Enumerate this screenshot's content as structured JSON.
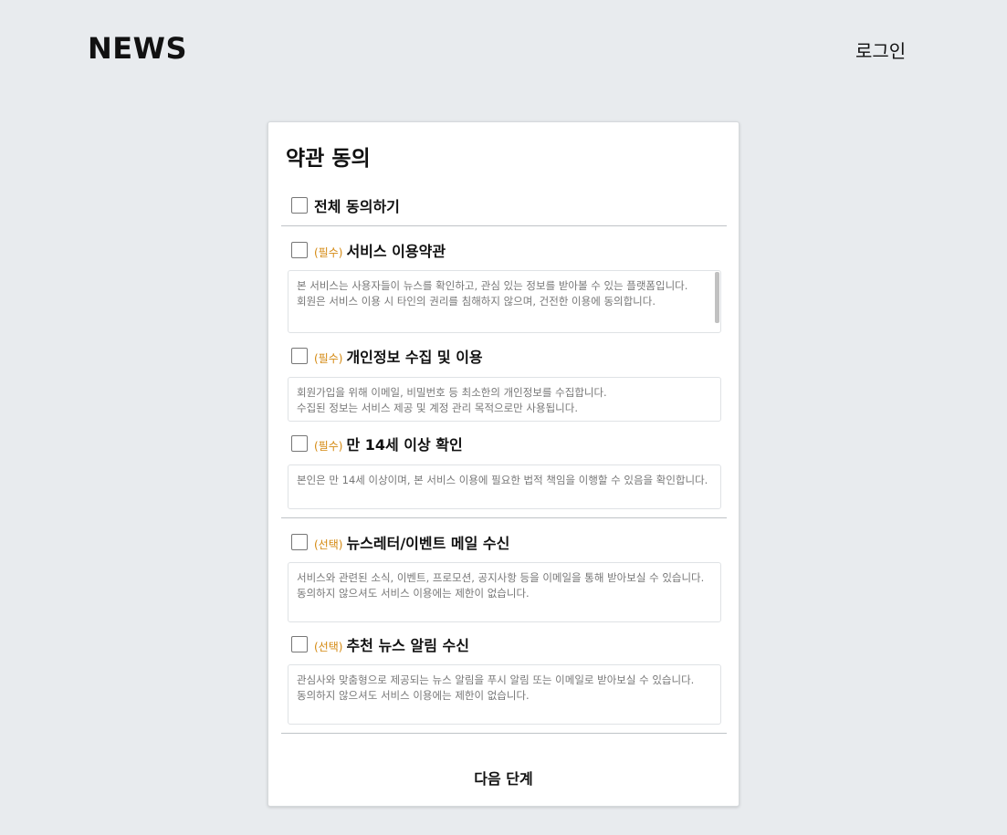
{
  "header": {
    "logo": "NEWS",
    "login": "로그인"
  },
  "card": {
    "title": "약관 동의",
    "agree_all": "전체 동의하기",
    "items": [
      {
        "tag": "(필수)",
        "label": "서비스 이용약관",
        "lines": [
          "본 서비스는 사용자들이 뉴스를 확인하고, 관심 있는 정보를 받아볼 수 있는 플랫폼입니다.",
          "회원은 서비스 이용 시 타인의 권리를 침해하지 않으며, 건전한 이용에 동의합니다."
        ]
      },
      {
        "tag": "(필수)",
        "label": "개인정보 수집 및 이용",
        "lines": [
          "회원가입을 위해 이메일, 비밀번호 등 최소한의 개인정보를 수집합니다.",
          "수집된 정보는 서비스 제공 및 계정 관리 목적으로만 사용됩니다."
        ]
      },
      {
        "tag": "(필수)",
        "label": "만 14세 이상 확인",
        "lines": [
          "본인은 만 14세 이상이며, 본 서비스 이용에 필요한 법적 책임을 이행할 수 있음을 확인합니다."
        ]
      },
      {
        "tag": "(선택)",
        "label": "뉴스레터/이벤트 메일 수신",
        "lines": [
          "서비스와 관련된 소식, 이벤트, 프로모션, 공지사항 등을 이메일을 통해 받아보실 수 있습니다.",
          "동의하지 않으셔도 서비스 이용에는 제한이 없습니다."
        ]
      },
      {
        "tag": "(선택)",
        "label": "추천 뉴스 알림 수신",
        "lines": [
          "관심사와 맞춤형으로 제공되는 뉴스 알림을 푸시 알림 또는 이메일로 받아보실 수 있습니다.",
          "동의하지 않으셔도 서비스 이용에는 제한이 없습니다."
        ]
      }
    ],
    "next": "다음 단계"
  },
  "colors": {
    "background": "#e8ebee",
    "tag": "#d4880f",
    "card": "#ffffff"
  }
}
